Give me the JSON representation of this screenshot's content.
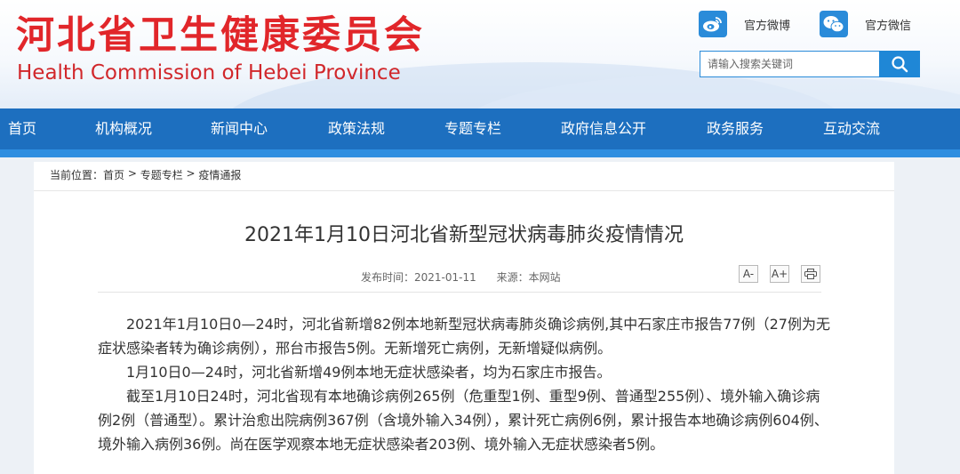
{
  "header": {
    "site_name_cn": "河北省卫生健康委员会",
    "site_name_en": "Health Commission of Hebei Province",
    "weibo_label": "官方微博",
    "wechat_label": "官方微信",
    "search_placeholder": "请输入搜索关键词",
    "icons": {
      "weibo": "weibo-icon",
      "wechat": "wechat-icon",
      "search": "search-icon"
    },
    "accent_color": "#1d6fbf",
    "logo_color": "#e1262a"
  },
  "nav": {
    "items": [
      "首页",
      "机构概况",
      "新闻中心",
      "政策法规",
      "专题专栏",
      "政府信息公开",
      "政务服务",
      "互动交流"
    ]
  },
  "breadcrumb": {
    "prefix": "当前位置：",
    "items": [
      "首页",
      "专题专栏",
      "疫情通报"
    ],
    "separator": " > "
  },
  "article": {
    "title": "2021年1月10日河北省新型冠状病毒肺炎疫情情况",
    "publish_label": "发布时间：",
    "publish_date": "2021-01-11",
    "source_label": "来源：",
    "source": "本网站",
    "tools": {
      "font_decrease": "A-",
      "font_increase": "A+",
      "print": "print-icon"
    },
    "paragraphs": [
      "2021年1月10日0—24时，河北省新增82例本地新型冠状病毒肺炎确诊病例,其中石家庄市报告77例（27例为无症状感染者转为确诊病例），邢台市报告5例。无新增死亡病例，无新增疑似病例。",
      "1月10日0—24时，河北省新增49例本地无症状感染者，均为石家庄市报告。",
      "截至1月10日24时，河北省现有本地确诊病例265例（危重型1例、重型9例、普通型255例）、境外输入确诊病例2例（普通型）。累计治愈出院病例367例（含境外输入34例），累计死亡病例6例，累计报告本地确诊病例604例、境外输入病例36例。尚在医学观察本地无症状感染者203例、境外输入无症状感染者5例。"
    ]
  }
}
